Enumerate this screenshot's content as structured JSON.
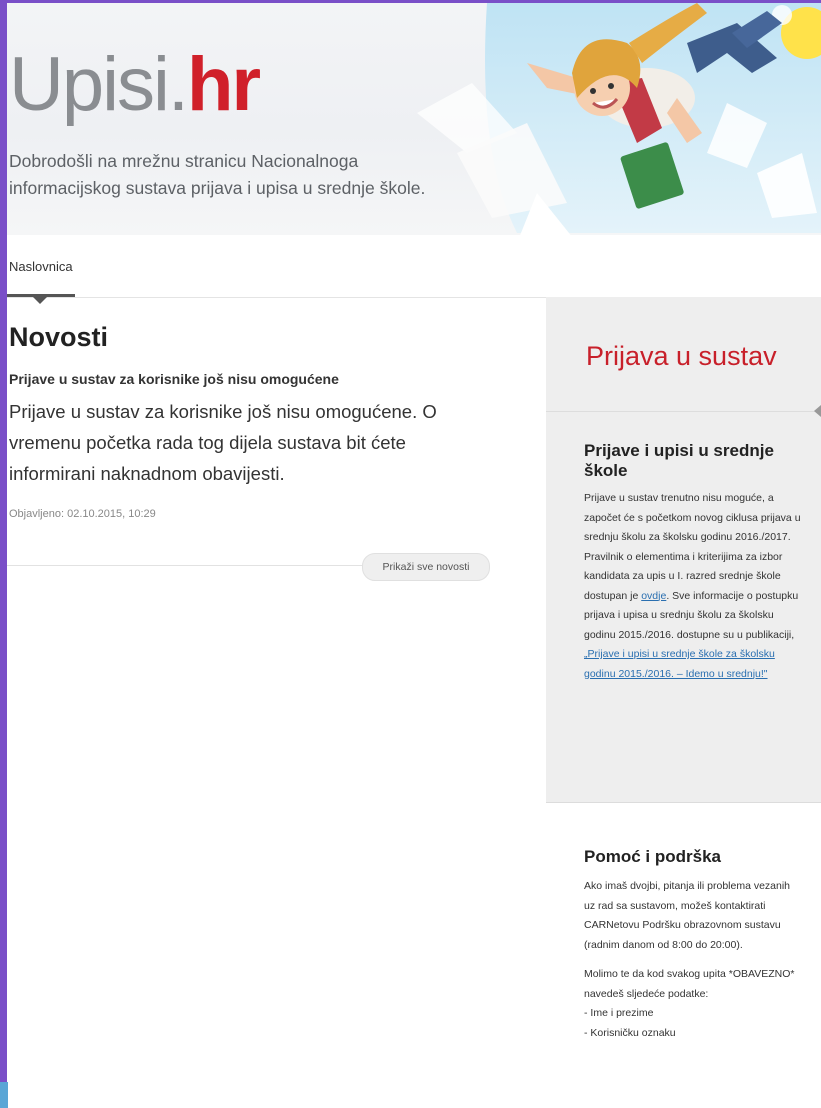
{
  "header": {
    "logo_part1": "Upisi.",
    "logo_part2": "hr",
    "tagline": "Dobrodošli na mrežnu stranicu Nacionalnoga informacijskog sustava prijava i upisa u srednje škole."
  },
  "nav": {
    "items": [
      {
        "label": "Naslovnica"
      }
    ]
  },
  "news": {
    "heading": "Novosti",
    "title": "Prijave u sustav za korisnike još nisu omogućene",
    "body": "Prijave u sustav za korisnike još nisu omogućene. O vremenu početka rada tog dijela sustava bit ćete informirani naknadnom obavijesti.",
    "date": "Objavljeno: 02.10.2015, 10:29",
    "all_news_label": "Prikaži sve novosti"
  },
  "sidebar": {
    "login_title": "Prijava u sustav",
    "enroll_title": "Prijave i upisi u srednje škole",
    "enroll_text_1": "Prijave u sustav trenutno nisu moguće, a započet će s početkom novog ciklusa prijava u srednju školu za školsku godinu 2016./2017. Pravilnik o elementima i kriterijima za izbor kandidata za upis u I. razred srednje škole dostupan je ",
    "enroll_link_1": "ovdje",
    "enroll_text_2": ". Sve informacije o postupku prijava i upisa u srednju školu za školsku godinu 2015./2016. dostupne su u publikaciji, ",
    "enroll_link_2": "„Prijave i upisi u srednje škole za školsku godinu 2015./2016. – Idemo u srednju!\"",
    "support_title": "Pomoć i podrška",
    "support_p1": "Ako imaš dvojbi, pitanja ili problema vezanih uz rad sa sustavom, možeš kontaktirati CARNetovu Podršku obrazovnom sustavu (radnim danom od 8:00 do 20:00).",
    "support_p2": "Molimo te da kod svakog upita *OBAVEZNO* navedeš sljedeće podatke:",
    "support_list": [
      "- Ime i prezime",
      "- Korisničku oznaku"
    ]
  },
  "colors": {
    "brand_red": "#d0202a",
    "logo_gray": "#8a8d91",
    "link_blue": "#2a6fb0",
    "frame_purple": "#7a4fc8"
  }
}
